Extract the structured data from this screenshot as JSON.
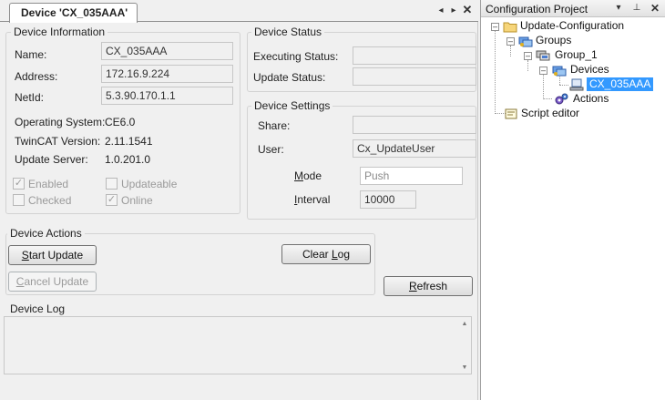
{
  "document": {
    "tab_title": "Device 'CX_035AAA'",
    "nav_left": "◂",
    "nav_right": "▸",
    "close": "✕"
  },
  "device_information": {
    "title": "Device Information",
    "name_label": "Name:",
    "name_value": "CX_035AAA",
    "address_label": "Address:",
    "address_value": "172.16.9.224",
    "netid_label": "NetId:",
    "netid_value": "5.3.90.170.1.1",
    "os_label": "Operating System:",
    "os_value": "CE6.0",
    "twincat_label": "TwinCAT Version:",
    "twincat_value": "2.11.1541",
    "update_server_label": "Update Server:",
    "update_server_value": "1.0.201.0",
    "checkboxes": [
      {
        "label": "Enabled",
        "checked": true
      },
      {
        "label": "Updateable",
        "checked": false
      },
      {
        "label": "Checked",
        "checked": false
      },
      {
        "label": "Online",
        "checked": true
      }
    ]
  },
  "device_status": {
    "title": "Device Status",
    "executing_label": "Executing Status:",
    "executing_value": "",
    "update_label": "Update Status:",
    "update_value": ""
  },
  "device_settings": {
    "title": "Device Settings",
    "share_label": "Share:",
    "share_value": "",
    "user_label": "User:",
    "user_value": "Cx_UpdateUser",
    "mode_label_prefix": "",
    "mode_label_u": "M",
    "mode_label_rest": "ode",
    "mode_value": "Push",
    "interval_label_u": "I",
    "interval_label_rest": "nterval",
    "interval_value": "10000"
  },
  "device_actions": {
    "title": "Device Actions",
    "start_update_u": "S",
    "start_update_rest": "tart Update",
    "cancel_update_u": "C",
    "cancel_update_rest": "ancel Update",
    "clear_log_pre": "Clear ",
    "clear_log_u": "L",
    "clear_log_rest": "og",
    "refresh_u": "R",
    "refresh_rest": "efresh"
  },
  "device_log": {
    "title": "Device Log",
    "scroll_up": "▲",
    "scroll_down": "▼"
  },
  "project": {
    "title": "Configuration Project",
    "btn_menu": "▾",
    "btn_pin": "⊥",
    "btn_close": "✕",
    "tree": {
      "root": "Update-Configuration",
      "groups": "Groups",
      "group1": "Group_1",
      "devices": "Devices",
      "device": "CX_035AAA",
      "actions": "Actions",
      "script_editor": "Script editor"
    }
  },
  "colors": {
    "selection": "#3399ff",
    "window_bg": "#f0f0f0"
  }
}
